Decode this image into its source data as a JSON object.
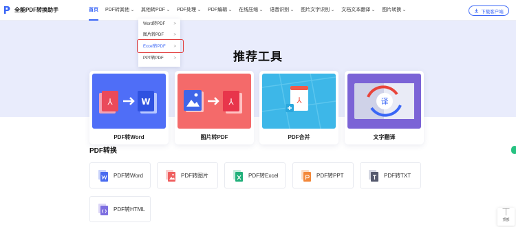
{
  "app": {
    "name": "全能PDF转换助手"
  },
  "nav": {
    "items": [
      {
        "label": "首页",
        "active": true,
        "has_dropdown": false
      },
      {
        "label": "PDF转其他",
        "has_dropdown": true
      },
      {
        "label": "其他转PDF",
        "has_dropdown": true
      },
      {
        "label": "PDF处理",
        "has_dropdown": true
      },
      {
        "label": "PDF编辑",
        "has_dropdown": true
      },
      {
        "label": "在线压缩",
        "has_dropdown": true
      },
      {
        "label": "语音识别",
        "has_dropdown": true
      },
      {
        "label": "图片文字识别",
        "has_dropdown": true
      },
      {
        "label": "文档文本翻译",
        "has_dropdown": true
      },
      {
        "label": "图片转换",
        "has_dropdown": true
      }
    ],
    "chevron": "⌄",
    "download_label": "下载客户端"
  },
  "dropdown": {
    "items": [
      {
        "label": "Word转PDF"
      },
      {
        "label": "图片转PDF"
      },
      {
        "label": "Excel转PDF",
        "highlighted": true
      },
      {
        "label": "PPT转PDF"
      }
    ],
    "arrow": ">"
  },
  "hero": {
    "title": "推荐工具"
  },
  "tools": [
    {
      "label": "PDF转Word",
      "icon": "pdf-to-word-illustration",
      "bg": "#4f6ef7"
    },
    {
      "label": "图片转PDF",
      "icon": "image-to-pdf-illustration",
      "bg": "#f46a6a"
    },
    {
      "label": "PDF合并",
      "icon": "pdf-merge-illustration",
      "bg": "#3db7e8"
    },
    {
      "label": "文字翻译",
      "icon": "text-translate-illustration",
      "bg": "#7b63d6"
    }
  ],
  "pdf_convert": {
    "title": "PDF转换",
    "items": [
      {
        "label": "PDF转Word",
        "icon": "word-doc-icon",
        "color": "#4a6cf0"
      },
      {
        "label": "PDF转图片",
        "icon": "image-doc-icon",
        "color": "#ef5e5e"
      },
      {
        "label": "PDF转Excel",
        "icon": "excel-doc-icon",
        "color": "#21b07a"
      },
      {
        "label": "PDF转PPT",
        "icon": "ppt-doc-icon",
        "color": "#f3883a"
      },
      {
        "label": "PDF转TXT",
        "icon": "txt-doc-icon",
        "color": "#555a6e"
      },
      {
        "label": "PDF转HTML",
        "icon": "html-doc-icon",
        "color": "#7d6ee0"
      }
    ]
  },
  "back_to_top": {
    "arrow": "⏉",
    "label": "顶部"
  },
  "colors": {
    "accent": "#3a66f6",
    "hero_bg": "#e9ecfc",
    "highlight_border": "#e23c3c"
  }
}
